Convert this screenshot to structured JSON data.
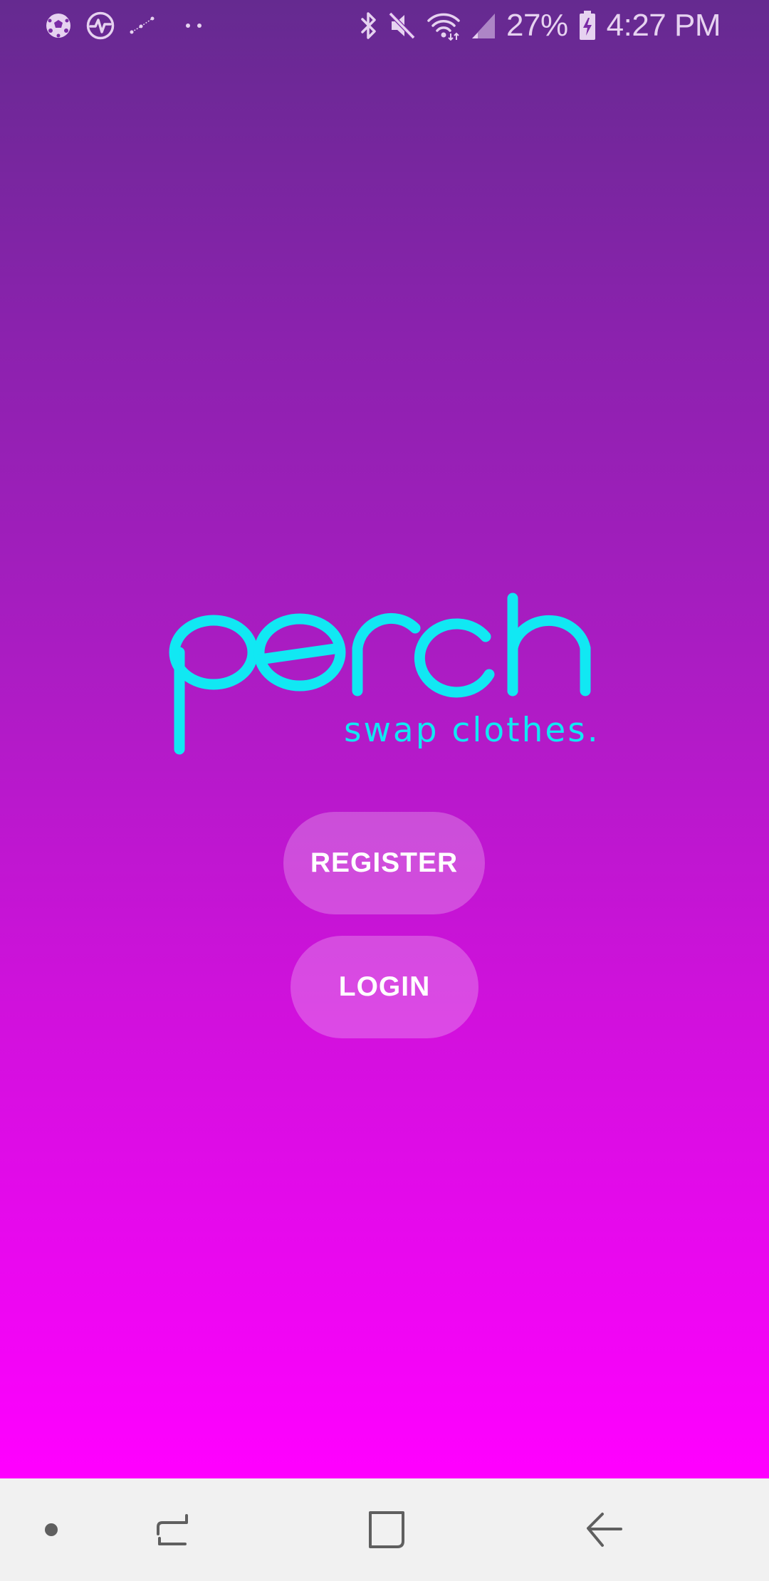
{
  "status_bar": {
    "left_icons": [
      "soccer-ball-icon",
      "pulse-icon",
      "constellation-icon",
      "more-dots-icon"
    ],
    "right_icons": [
      "bluetooth-icon",
      "mute-icon",
      "wifi-icon",
      "signal-icon",
      "battery-charging-icon"
    ],
    "battery_text": "27%",
    "time": "4:27 PM"
  },
  "app": {
    "logo_text": "perch",
    "tagline": "swap clothes.",
    "register_label": "REGISTER",
    "login_label": "LOGIN"
  },
  "nav_bar": {
    "items": [
      "dot-icon",
      "recents-icon",
      "home-icon",
      "back-icon"
    ]
  },
  "colors": {
    "gradient_top": "#652a90",
    "gradient_bottom": "#ff00ff",
    "logo": "#11e8f3",
    "button_fill": "rgba(255,255,255,0.24)",
    "nav_bg": "#f1f1f1"
  }
}
